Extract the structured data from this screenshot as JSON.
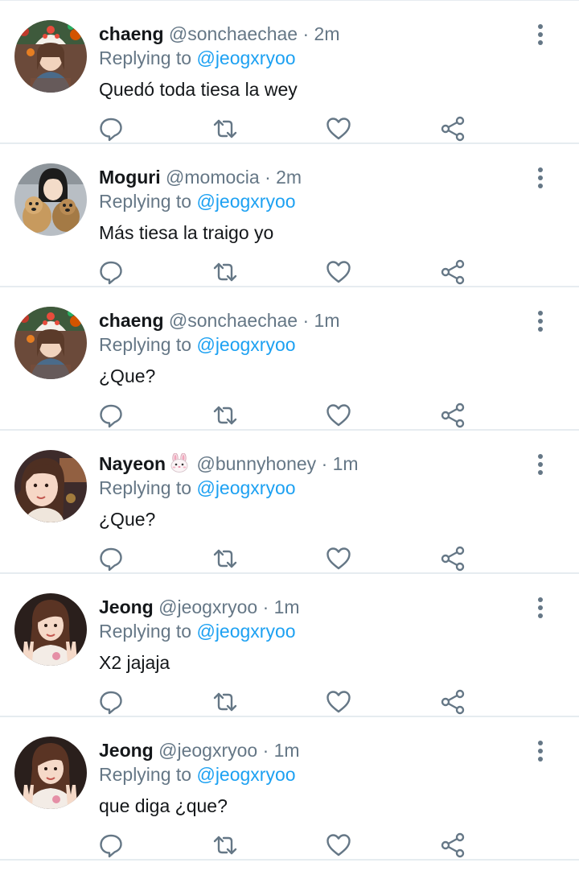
{
  "tweets": [
    {
      "name": "chaeng",
      "handle": "@sonchaechae",
      "time": "· 2m",
      "reply_prefix": "Replying to",
      "reply_to": "@jeogxryoo",
      "text": "Quedó toda tiesa la wey"
    },
    {
      "name": "Moguri",
      "handle": "@momocia",
      "time": "· 2m",
      "reply_prefix": "Replying to",
      "reply_to": "@jeogxryoo",
      "text": "Más tiesa la traigo yo"
    },
    {
      "name": "chaeng",
      "handle": "@sonchaechae",
      "time": "· 1m",
      "reply_prefix": "Replying to",
      "reply_to": "@jeogxryoo",
      "text": "¿Que?"
    },
    {
      "name": "Nayeon",
      "name_emoji": "rabbit-face-emoji",
      "handle": "@bunnyhoney",
      "time": "· 1m",
      "reply_prefix": "Replying to",
      "reply_to": "@jeogxryoo",
      "text": "¿Que?"
    },
    {
      "name": "Jeong",
      "handle": "@jeogxryoo",
      "time": "· 1m",
      "reply_prefix": "Replying to",
      "reply_to": "@jeogxryoo",
      "text": "X2 jajaja"
    },
    {
      "name": "Jeong",
      "handle": "@jeogxryoo",
      "time": "· 1m",
      "reply_prefix": "Replying to",
      "reply_to": "@jeogxryoo",
      "text": "que diga ¿que?"
    }
  ],
  "icons": {
    "reply": "reply-icon",
    "retweet": "retweet-icon",
    "like": "heart-icon",
    "share": "share-icon",
    "more": "more-options-icon"
  },
  "colors": {
    "text": "#14171a",
    "secondary": "#657786",
    "link": "#1da1f2",
    "icon": "#657786",
    "divider": "#e6ecf0"
  }
}
